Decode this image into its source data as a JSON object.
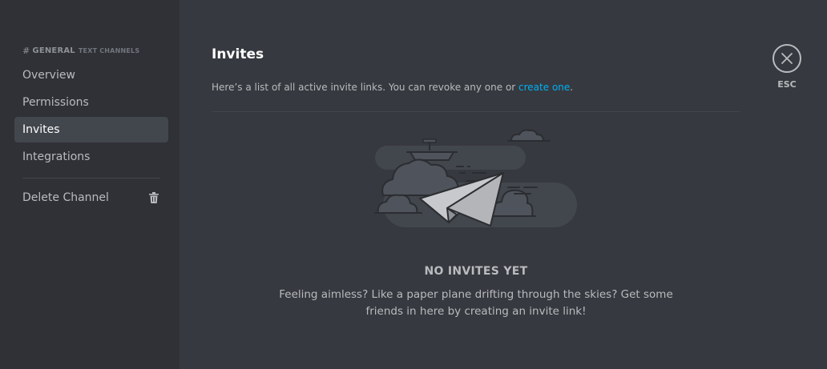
{
  "sidebar": {
    "header": {
      "hash": "#",
      "channel": "GENERAL",
      "subtitle": "TEXT CHANNELS"
    },
    "items": [
      {
        "label": "Overview"
      },
      {
        "label": "Permissions"
      },
      {
        "label": "Invites",
        "selected": true
      },
      {
        "label": "Integrations"
      }
    ],
    "delete": {
      "label": "Delete Channel",
      "icon": "trash-icon"
    }
  },
  "main": {
    "title": "Invites",
    "description": "Here’s a list of all active invite links. You can revoke any one or ",
    "description_link": "create one",
    "description_end": ".",
    "empty_title": "NO INVITES YET",
    "empty_body": "Feeling aimless? Like a paper plane drifting through the skies? Get some friends in here by creating an invite link!"
  },
  "close": {
    "label": "ESC",
    "icon": "close-icon"
  },
  "colors": {
    "background": "#36393f",
    "sidebar": "#2f3136",
    "selected": "#42464d",
    "link": "#00b0f4",
    "text": "#b9bbbe"
  }
}
